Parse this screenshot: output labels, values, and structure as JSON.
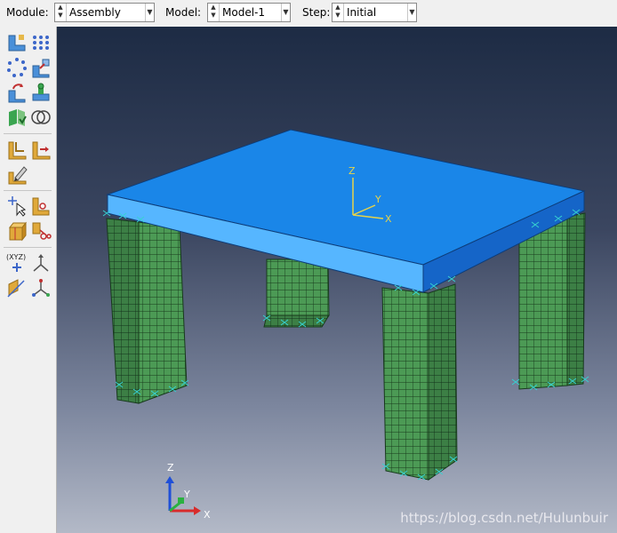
{
  "toolbar": {
    "module": {
      "label": "Module:",
      "value": "Assembly"
    },
    "model": {
      "label": "Model:",
      "value": "Model-1"
    },
    "step": {
      "label": "Step:",
      "value": "Initial"
    }
  },
  "toolbox": {
    "coord_label": "(XYZ)"
  },
  "viewport": {
    "part_triad": {
      "z": "Z",
      "y": "Y",
      "x": "X"
    },
    "global_triad": {
      "z": "Z",
      "y": "Y",
      "x": "X"
    },
    "watermark": "https://blog.csdn.net/Hulunbuir",
    "colors": {
      "slab_top": "#1a86e8",
      "slab_front": "#56b6ff",
      "slab_side": "#1565c8",
      "leg_mesh": "#4c9a55",
      "bc_marker": "#36d1d1"
    }
  }
}
